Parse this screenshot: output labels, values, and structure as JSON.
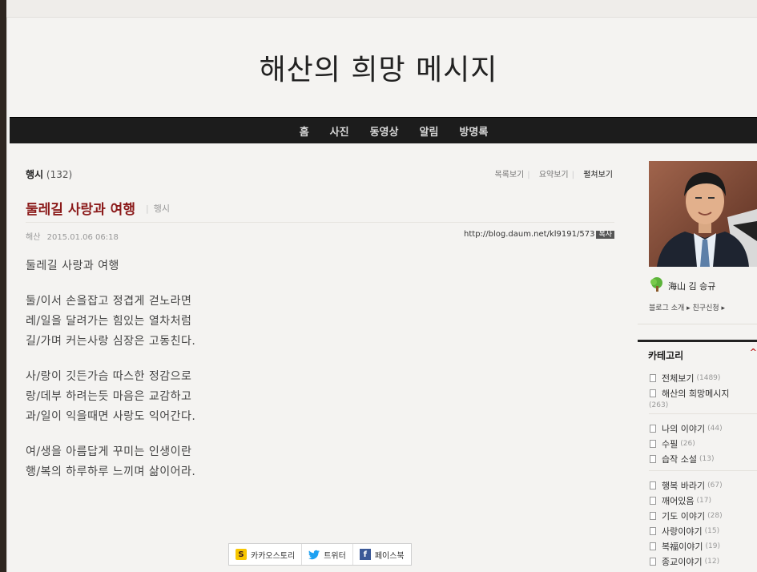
{
  "blog": {
    "title": "해산의 희망 메시지"
  },
  "nav": {
    "items": [
      "홈",
      "사진",
      "동영상",
      "알림",
      "방명록"
    ]
  },
  "category_line": {
    "name": "행시",
    "count": "(132)"
  },
  "view_modes": [
    "목록보기",
    "요약보기",
    "펼쳐보기"
  ],
  "post": {
    "title": "둘레길 사랑과 여행",
    "category": "행시",
    "author": "해산",
    "datetime": "2015.01.06 06:18",
    "url": "http://blog.daum.net/kl9191/573",
    "copy_label": "복사",
    "heading_line": "둘레길 사랑과 여행",
    "stanzas": [
      [
        "둘/이서 손을잡고 정겹게 걷노라면",
        "레/일을 달려가는 힘있는 열차처럼",
        "길/가며 커는사랑 심장은 고동친다."
      ],
      [
        "사/랑이 깃든가슴 따스한 정감으로",
        "랑/데부 하려는듯 마음은 교감하고",
        "과/일이 익을때면 사랑도 익어간다."
      ],
      [
        "여/생을 아름답게 꾸미는 인생이란",
        "행/복의 하루하루 느끼며 삶이어라."
      ]
    ]
  },
  "share": {
    "kakao": "카카오스토리",
    "twitter": "트위터",
    "facebook": "페이스북"
  },
  "sidebar": {
    "profile_name": "海山 김 승규",
    "profile_links": {
      "intro": "블로그 소개",
      "friend": "친구신청"
    },
    "category_header": "카테고리",
    "groups": [
      [
        {
          "label": "전체보기",
          "count": "(1489)"
        },
        {
          "label": "해산의 희망메시지",
          "count": "(263)",
          "wrap": true
        }
      ],
      [
        {
          "label": "나의 이야기",
          "count": "(44)"
        },
        {
          "label": "수필",
          "count": "(26)"
        },
        {
          "label": "습작 소설",
          "count": "(13)"
        }
      ],
      [
        {
          "label": "행복 바라기",
          "count": "(67)"
        },
        {
          "label": "깨어있음",
          "count": "(17)"
        },
        {
          "label": "기도 이야기",
          "count": "(28)"
        },
        {
          "label": "사랑이야기",
          "count": "(15)"
        },
        {
          "label": "복福이야기",
          "count": "(19)"
        },
        {
          "label": "종교이야기",
          "count": "(12)"
        }
      ]
    ]
  },
  "colors": {
    "title_red": "#8b1a1a",
    "nav_bg": "#1c1c1c",
    "paper_bg": "#f4f3f1"
  }
}
